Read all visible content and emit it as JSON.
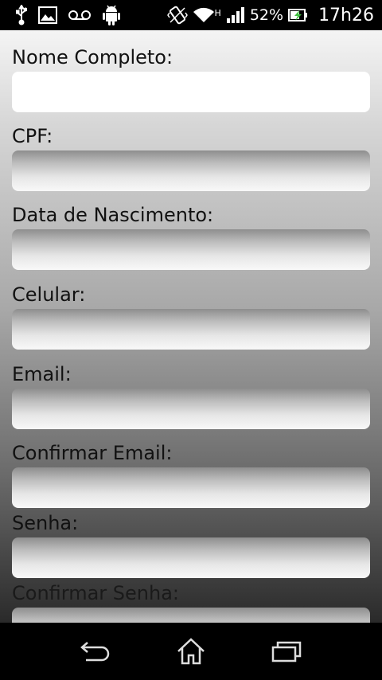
{
  "status_bar": {
    "icons_left": [
      "usb-icon",
      "image-icon",
      "voicemail-icon",
      "android-icon"
    ],
    "icons_right": [
      "vibrate-icon",
      "wifi-icon",
      "signal-icon",
      "battery-charging-icon"
    ],
    "network_type": "H",
    "battery": "52%",
    "time": "17h26"
  },
  "form": {
    "fields": [
      {
        "label": "Nome Completo:",
        "value": "",
        "placeholder": ""
      },
      {
        "label": "CPF:",
        "value": "",
        "placeholder": ""
      },
      {
        "label": "Data de Nascimento:",
        "value": "",
        "placeholder": ""
      },
      {
        "label": "Celular:",
        "value": "",
        "placeholder": ""
      },
      {
        "label": "Email:",
        "value": "",
        "placeholder": ""
      },
      {
        "label": "Confirmar Email:",
        "value": "",
        "placeholder": ""
      },
      {
        "label": "Senha:",
        "value": "",
        "placeholder": ""
      },
      {
        "label": "Confirmar Senha:",
        "value": "",
        "placeholder": ""
      }
    ]
  },
  "nav_bar": {
    "buttons": [
      "back-icon",
      "home-icon",
      "recent-apps-icon"
    ]
  }
}
